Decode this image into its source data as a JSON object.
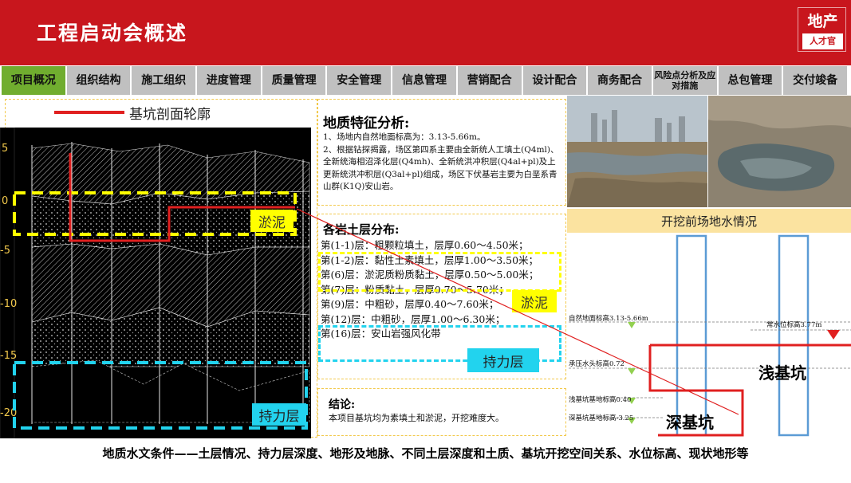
{
  "header": {
    "title": "工程启动会概述",
    "logo_top": "地产",
    "logo_bottom": "人才官"
  },
  "nav": [
    {
      "label": "项目概况",
      "active": true
    },
    {
      "label": "组织结构"
    },
    {
      "label": "施工组织"
    },
    {
      "label": "进度管理"
    },
    {
      "label": "质量管理"
    },
    {
      "label": "安全管理"
    },
    {
      "label": "信息管理"
    },
    {
      "label": "营销配合"
    },
    {
      "label": "设计配合"
    },
    {
      "label": "商务配合"
    },
    {
      "label": "风险点分析及应对措施"
    },
    {
      "label": "总包管理"
    },
    {
      "label": "交付竣备"
    }
  ],
  "profile": {
    "legend": "基坑剖面轮廓",
    "axis_ticks": [
      "5",
      "0",
      "-5",
      "-10",
      "-15",
      "-20"
    ],
    "tag_silt": "淤泥",
    "tag_bearing": "持力层"
  },
  "geology": {
    "heading": "地质特征分析:",
    "text": "1、场地内自然地面标高为：3.13-5.66m。\n2、根据钻探揭露，场区第四系主要由全新统人工填土(Q4ml)、全新统海相沼泽化层(Q4mh)、全新统洪冲积层(Q4al+pl)及上更新统洪冲积层(Q3al+pl)组成，场区下伏基岩主要为白垩系青山群(K1Q)安山岩。"
  },
  "soil": {
    "heading": "各岩土层分布:",
    "layers": [
      "第(1-1)层：粗颗粒填土，层厚0.60～4.50米；",
      "第(1-2)层：黏性土素填土，层厚1.00～3.50米；",
      "第(6)层：淤泥质粉质黏土，层厚0.50～5.00米；",
      "第(7)层：粉质黏土，层厚0.70～5.70米；",
      "第(9)层：中粗砂，层厚0.40～7.60米；",
      "第(12)层：中粗砂，层厚1.00～6.30米；",
      "第(16)层：安山岩强风化带"
    ],
    "tag_silt": "淤泥",
    "tag_bearing": "持力层"
  },
  "conclusion": {
    "heading": "结论:",
    "text": "本项目基坑均为素填土和淤泥，开挖难度大。"
  },
  "photo_caption": "开挖前场地水情况",
  "section": {
    "ground_label": "自然地面标高3.13-5.66m",
    "water_label": "常水位标高3.77m",
    "artesian_label": "承压水头标高0.72",
    "shallow_base_label": "浅基坑基地标高0.40",
    "deep_base_label": "深基坑基地标高-3.25",
    "shallow_pit": "浅基坑",
    "deep_pit": "深基坑"
  },
  "footer": "地质水文条件——土层情况、持力层深度、地形及地脉、不同土层深度和土质、基坑开挖空间关系、水位标高、现状地形等",
  "colors": {
    "brand_red": "#c8161d",
    "tab_active": "#70ad2f",
    "tab_bg": "#c0c0c0",
    "highlight_yellow": "#ffff00",
    "highlight_cyan": "#22d3ee"
  }
}
